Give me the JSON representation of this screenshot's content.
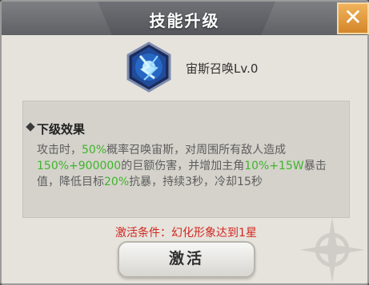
{
  "dialog": {
    "title": "技能升级",
    "close_label": "✕",
    "skill": {
      "name": "宙斯召唤Lv.0",
      "icon": "lightning-crystal-icon"
    },
    "effect_title": "下级效果",
    "effect_parts": [
      {
        "text": "攻击时，",
        "highlight": false
      },
      {
        "text": "50%",
        "highlight": true
      },
      {
        "text": "概率召唤宙斯，对周围所有敌人造成",
        "highlight": false
      },
      {
        "text": "150%+900000",
        "highlight": true
      },
      {
        "text": "的巨额伤害，并增加主角",
        "highlight": false
      },
      {
        "text": "10%+15W",
        "highlight": true
      },
      {
        "text": "暴击值，降低目标",
        "highlight": false
      },
      {
        "text": "20%",
        "highlight": true
      },
      {
        "text": "抗暴，持续3秒，冷却15秒",
        "highlight": false
      }
    ],
    "condition": "激活条件：幻化形象达到1星",
    "activate_label": "激活",
    "colors": {
      "highlight": "#3db52a",
      "condition": "#d1271f",
      "close": "#e39a3a"
    }
  }
}
